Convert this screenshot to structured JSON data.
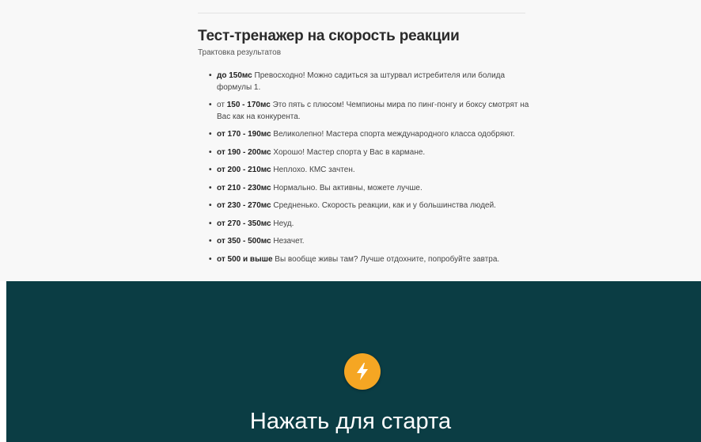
{
  "header": {
    "title": "Тест-тренажер на скорость реакции",
    "subtitle": "Трактовка результатов"
  },
  "results": [
    {
      "range": "до 150мс",
      "text": " Превосходно! Можно садиться за штурвал истребителя или болида формулы 1."
    },
    {
      "prefix": "от ",
      "range": "150 - 170мс",
      "text": " Это пять с плюсом! Чемпионы мира по пинг-понгу и боксу смотрят на Вас как на конкурента."
    },
    {
      "range": "от 170 - 190мс",
      "text": " Великолепно! Мастера спорта международного класса одобряют."
    },
    {
      "range": "от 190 - 200мс",
      "text": " Хорошо! Мастер спорта у Вас в кармане."
    },
    {
      "range": "от 200 - 210мс",
      "text": " Неплохо. КМС зачтен."
    },
    {
      "range": "от 210 - 230мс",
      "text": " Нормально. Вы активны, можете лучше."
    },
    {
      "range": "от 230 - 270мс",
      "text": " Средненько. Скорость реакции, как и у большинства людей."
    },
    {
      "range": "от 270 - 350мс",
      "text": " Неуд."
    },
    {
      "range": "от 350 - 500мс",
      "text": " Незачет."
    },
    {
      "range": "от 500 и выше",
      "text": " Вы вообще живы там? Лучше отдохните, попробуйте завтра."
    }
  ],
  "start": {
    "icon": "lightning-bolt-icon",
    "label": "Нажать для старта"
  },
  "colors": {
    "top_background": "#f8f8f8",
    "bottom_background": "#0b3d44",
    "accent": "#f5a623"
  }
}
